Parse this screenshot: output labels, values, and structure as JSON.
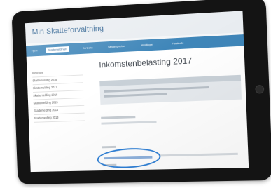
{
  "site": {
    "title": "Min Skatteforvaltning"
  },
  "nav": {
    "tabs": [
      "Hjem",
      "Skattemeldinger",
      "Innboks",
      "Selvangivelse",
      "Meldinger",
      "Forskudd"
    ],
    "active_index": 1
  },
  "sidebar": {
    "items": [
      "Inntekter",
      "Skattemelding 2018",
      "Skattemelding 2017",
      "Skattemelding 2016",
      "Skattemelding 2015",
      "Skattemelding 2014",
      "Skattemelding 2013"
    ]
  },
  "page": {
    "title": "Inkomstenbelasting 2017"
  },
  "highlight": {
    "color": "#2d7fd6"
  }
}
